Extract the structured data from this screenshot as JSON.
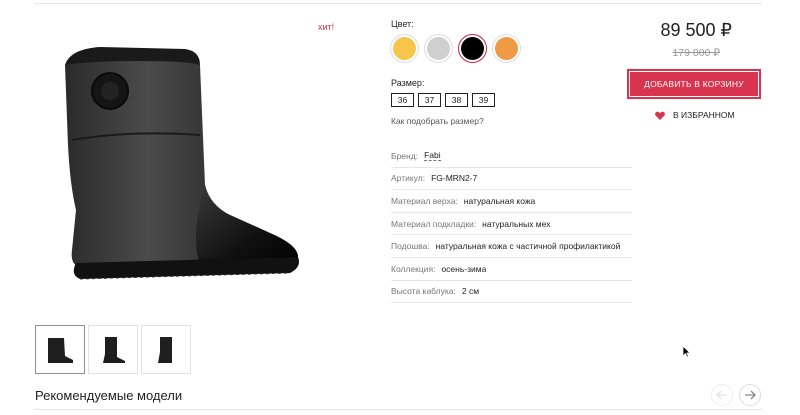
{
  "badge": "хит!",
  "color": {
    "label": "Цвет:",
    "swatches": [
      {
        "name": "yellow",
        "hex": "#f6c54c"
      },
      {
        "name": "gray",
        "hex": "#cfcfcf"
      },
      {
        "name": "black",
        "hex": "#000000",
        "selected": true
      },
      {
        "name": "orange",
        "hex": "#ef9a45"
      }
    ]
  },
  "size": {
    "label": "Размер:",
    "options": [
      "36",
      "37",
      "38",
      "39"
    ],
    "help": "Как подобрать размер?"
  },
  "specs": [
    {
      "key": "Бренд:",
      "value": "Fabi"
    },
    {
      "key": "Артикул:",
      "value": "FG-MRN2-7"
    },
    {
      "key": "Материал верха:",
      "value": "натуральная кожа"
    },
    {
      "key": "Материал подкладки:",
      "value": "натуральных мех"
    },
    {
      "key": "Подошва:",
      "value": "натуральная кожа с частичной профилактикой"
    },
    {
      "key": "Коллекция:",
      "value": "осень-зима"
    },
    {
      "key": "Высота каблука:",
      "value": "2 см"
    }
  ],
  "price": {
    "current": "89 500 ₽",
    "old": "179 000 ₽"
  },
  "buttons": {
    "add_to_cart": "Добавить в корзину",
    "favorite": "В ИЗБРАННОМ"
  },
  "recommended": {
    "title": "Рекомендуемые модели"
  },
  "colors": {
    "accent": "#d8344f"
  }
}
